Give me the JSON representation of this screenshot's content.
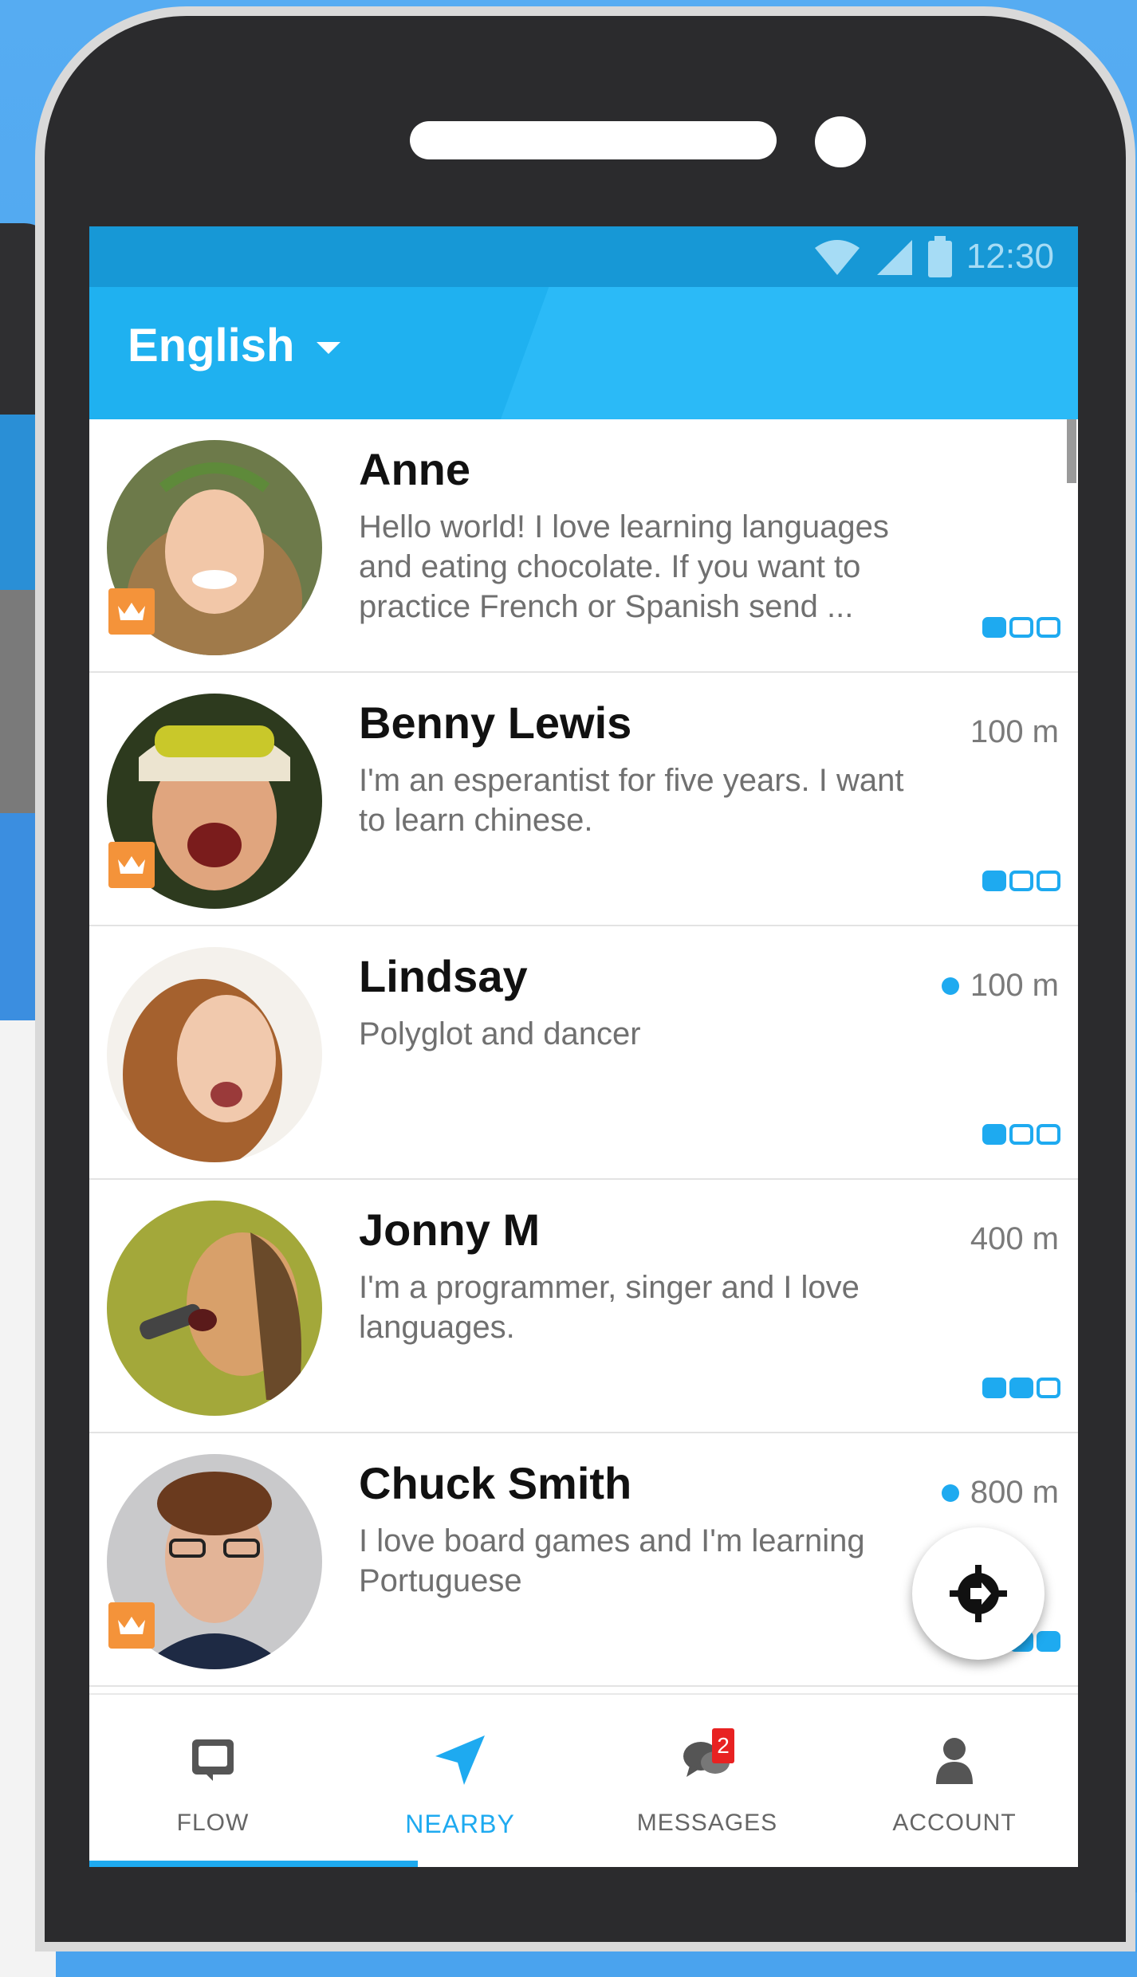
{
  "status_bar": {
    "time": "12:30",
    "icons": [
      "wifi-icon",
      "signal-icon",
      "battery-icon"
    ]
  },
  "app_bar": {
    "language": "English"
  },
  "users": [
    {
      "name": "Anne",
      "bio": "Hello world! I love learning languages and eating chocolate. If you want to practice French or Spanish send ...",
      "distance": "",
      "online": false,
      "premium": true,
      "level": 1
    },
    {
      "name": "Benny Lewis",
      "bio": "I'm an esperantist for five years. I want to learn chinese.",
      "distance": "100 m",
      "online": false,
      "premium": true,
      "level": 1
    },
    {
      "name": "Lindsay",
      "bio": "Polyglot and dancer",
      "distance": "100 m",
      "online": true,
      "premium": false,
      "level": 1
    },
    {
      "name": "Jonny M",
      "bio": "I'm a programmer, singer and I love languages.",
      "distance": "400 m",
      "online": false,
      "premium": false,
      "level": 2
    },
    {
      "name": "Chuck Smith",
      "bio": "I love board games and I'm learning Portuguese",
      "distance": "800 m",
      "online": true,
      "premium": true,
      "level": 3
    }
  ],
  "nav": {
    "flow": "FLOW",
    "nearby": "NEARBY",
    "messages": "MESSAGES",
    "messages_badge": "2",
    "account": "ACCOUNT"
  },
  "colors": {
    "accent": "#1eaaf0",
    "app_bar": "#1fb1f0",
    "premium": "#f4933a",
    "badge": "#e82222"
  }
}
